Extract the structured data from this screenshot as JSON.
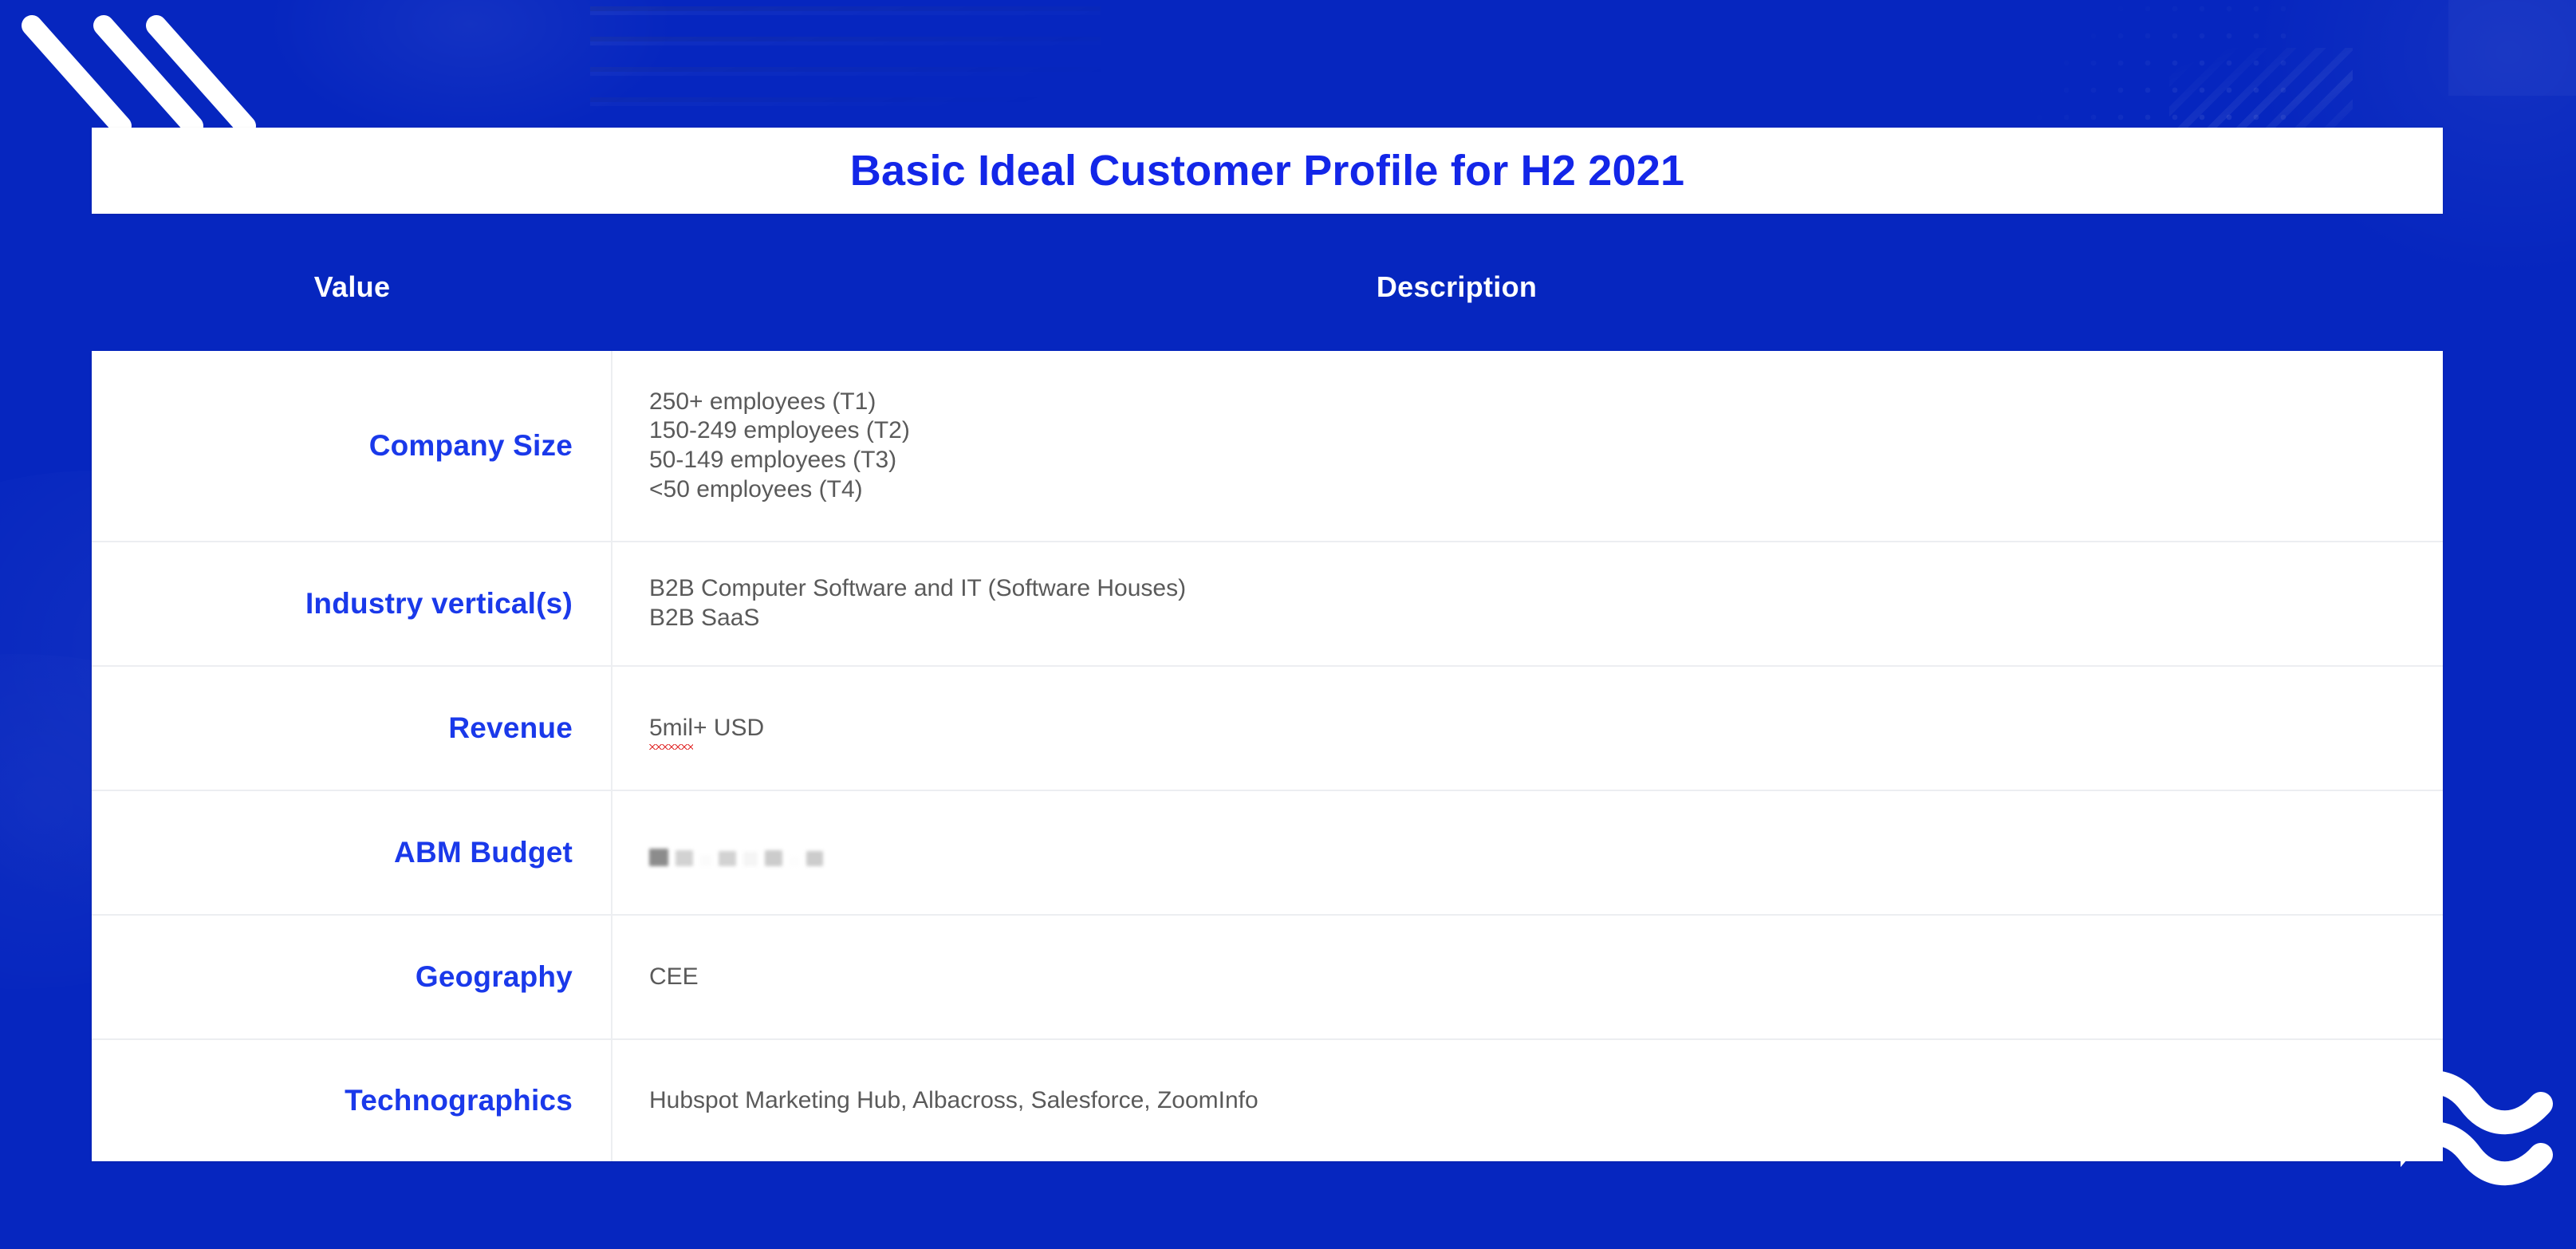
{
  "theme": {
    "background_blue": "#0626bf",
    "title_blue": "#1326e8",
    "label_blue": "#1a39ea",
    "description_gray": "#5a5a5a",
    "card_white": "#ffffff",
    "row_divider": "#eceef1",
    "spellcheck_red": "#e02b2b"
  },
  "title": {
    "text": "Basic Ideal Customer Profile for H2 2021"
  },
  "table": {
    "headers": {
      "value": "Value",
      "description": "Description"
    },
    "rows": [
      {
        "label": "Company Size",
        "description": "250+ employees (T1)\n150-249 employees (T2)\n50-149 employees (T3)\n<50 employees (T4)",
        "redacted": false
      },
      {
        "label": "Industry vertical(s)",
        "description": "B2B Computer Software and IT (Software Houses)\nB2B SaaS",
        "redacted": false
      },
      {
        "label": "Revenue",
        "description": "5mil+ USD",
        "misspelled_token": "5mil",
        "rest_token": "+ USD",
        "redacted": false
      },
      {
        "label": "ABM Budget",
        "description": "",
        "redacted": true,
        "redaction_note": "value obscured / blurred out"
      },
      {
        "label": "Geography",
        "description": "CEE",
        "redacted": false
      },
      {
        "label": "Technographics",
        "description": "Hubspot Marketing Hub, Albacross, Salesforce, ZoomInfo",
        "redacted": false
      }
    ]
  },
  "decorations": {
    "diagonal_stripes": "three-white-diagonal-stripes",
    "wave_logo": "double-wave-logo-mark",
    "background_pattern": "dots-and-lines"
  }
}
